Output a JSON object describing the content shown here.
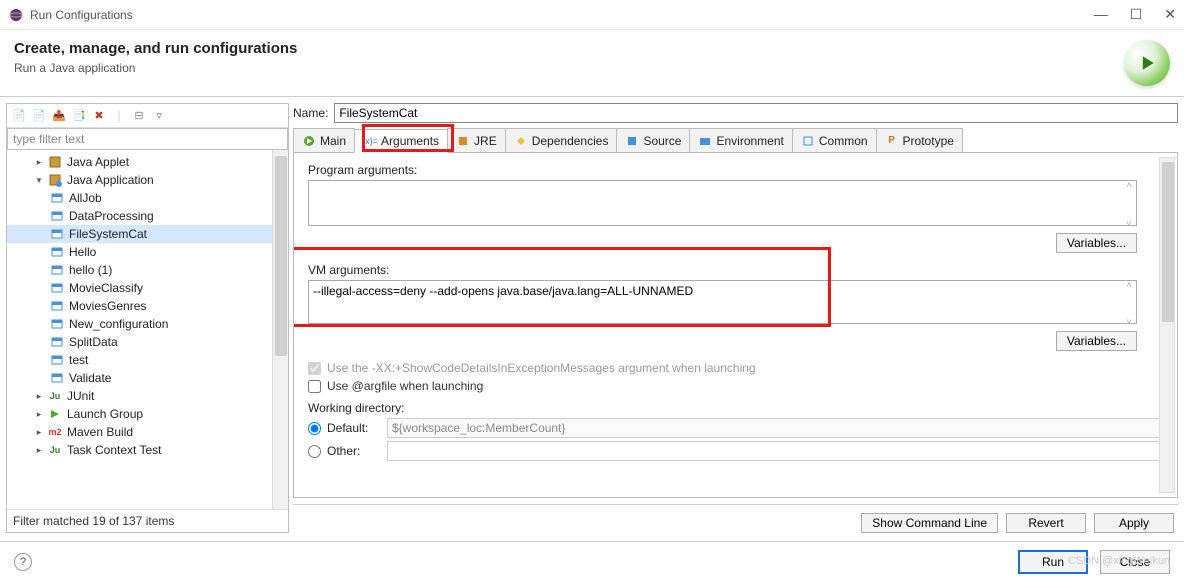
{
  "window": {
    "title": "Run Configurations"
  },
  "header": {
    "title": "Create, manage, and run configurations",
    "subtitle": "Run a Java application"
  },
  "left": {
    "filter_placeholder": "type filter text",
    "tree": {
      "items": [
        {
          "label": "Java Applet",
          "indent": 1,
          "kind": "applet"
        },
        {
          "label": "Java Application",
          "indent": 1,
          "kind": "app",
          "expanded": true
        },
        {
          "label": "AllJob",
          "indent": 2,
          "kind": "cfg"
        },
        {
          "label": "DataProcessing",
          "indent": 2,
          "kind": "cfg"
        },
        {
          "label": "FileSystemCat",
          "indent": 2,
          "kind": "cfg",
          "selected": true
        },
        {
          "label": "Hello",
          "indent": 2,
          "kind": "cfg"
        },
        {
          "label": "hello (1)",
          "indent": 2,
          "kind": "cfg"
        },
        {
          "label": "MovieClassify",
          "indent": 2,
          "kind": "cfg"
        },
        {
          "label": "MoviesGenres",
          "indent": 2,
          "kind": "cfg"
        },
        {
          "label": "New_configuration",
          "indent": 2,
          "kind": "cfg"
        },
        {
          "label": "SplitData",
          "indent": 2,
          "kind": "cfg"
        },
        {
          "label": "test",
          "indent": 2,
          "kind": "cfg"
        },
        {
          "label": "Validate",
          "indent": 2,
          "kind": "cfg"
        },
        {
          "label": "JUnit",
          "indent": 1,
          "kind": "junit"
        },
        {
          "label": "Launch Group",
          "indent": 1,
          "kind": "launch"
        },
        {
          "label": "Maven Build",
          "indent": 1,
          "kind": "maven"
        },
        {
          "label": "Task Context Test",
          "indent": 1,
          "kind": "task"
        }
      ]
    },
    "status": "Filter matched 19 of 137 items"
  },
  "right": {
    "name_label": "Name:",
    "name_value": "FileSystemCat",
    "tabs": [
      {
        "id": "main",
        "label": "Main"
      },
      {
        "id": "arguments",
        "label": "Arguments",
        "active": true
      },
      {
        "id": "jre",
        "label": "JRE"
      },
      {
        "id": "dependencies",
        "label": "Dependencies"
      },
      {
        "id": "source",
        "label": "Source"
      },
      {
        "id": "environment",
        "label": "Environment"
      },
      {
        "id": "common",
        "label": "Common"
      },
      {
        "id": "prototype",
        "label": "Prototype"
      }
    ],
    "program_args_label": "Program arguments:",
    "program_args_value": "",
    "variables_label": "Variables...",
    "vm_args_label": "VM arguments:",
    "vm_args_value": "--illegal-access=deny --add-opens java.base/java.lang=ALL-UNNAMED",
    "chk_xx": "Use the -XX:+ShowCodeDetailsInExceptionMessages argument when launching",
    "chk_argfile": "Use @argfile when launching",
    "workdir_label": "Working directory:",
    "default_label": "Default:",
    "default_value": "${workspace_loc:MemberCount}",
    "other_label": "Other:",
    "buttons": {
      "showcmd": "Show Command Line",
      "revert": "Revert",
      "apply": "Apply"
    }
  },
  "footer": {
    "run": "Run",
    "close": "Close"
  },
  "watermark": "CSDN @xingWeikun"
}
